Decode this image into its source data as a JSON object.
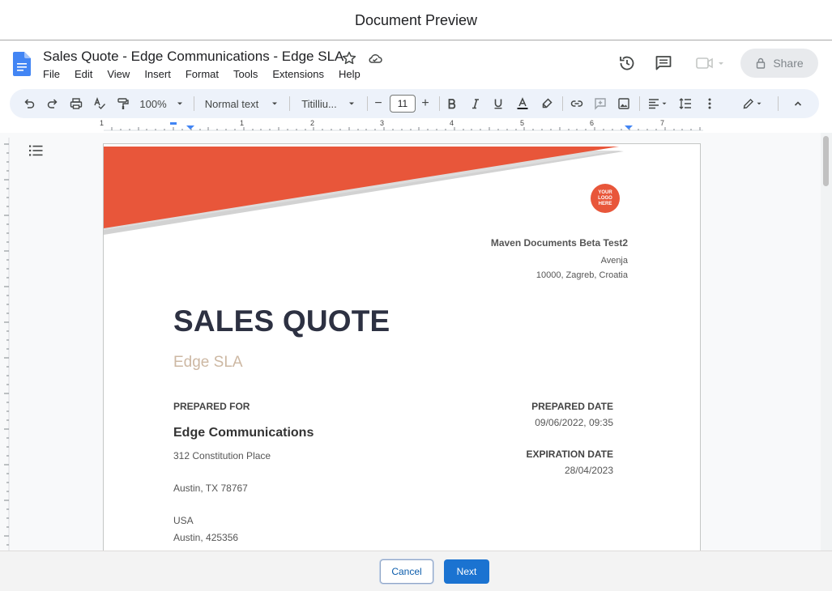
{
  "modal": {
    "title": "Document Preview"
  },
  "docs": {
    "title": "Sales Quote - Edge Communications - Edge SLA",
    "menu": [
      "File",
      "Edit",
      "View",
      "Insert",
      "Format",
      "Tools",
      "Extensions",
      "Help"
    ],
    "share_label": "Share",
    "icons": {
      "docs": "docs-icon",
      "star": "star-icon",
      "cloud": "cloud-icon",
      "history": "history-icon",
      "comments": "comment-icon",
      "meet": "video-icon",
      "lock": "lock-icon"
    }
  },
  "toolbar": {
    "zoom": "100%",
    "style": "Normal text",
    "font": "Titilliu...",
    "font_size": "11",
    "minus": "−",
    "plus": "+"
  },
  "ruler": {
    "numbers": [
      "1",
      "1",
      "2",
      "3",
      "4",
      "5",
      "6",
      "7"
    ]
  },
  "page": {
    "logo_text": "YOUR LOGO HERE",
    "company_name": "Maven Documents Beta Test2",
    "company_line1": "Avenja",
    "company_line2": "10000, Zagreb, Croatia",
    "heading": "SALES QUOTE",
    "subheading": "Edge SLA",
    "prepared_for_label": "PREPARED FOR",
    "client_name": "Edge Communications",
    "client_address1": "312 Constitution Place",
    "client_address2": "Austin, TX 78767",
    "client_country": "USA",
    "client_city_zip": "Austin, 425356",
    "prepared_date_label": "PREPARED DATE",
    "prepared_date": "09/06/2022, 09:35",
    "expiration_date_label": "EXPIRATION DATE",
    "expiration_date": "28/04/2023",
    "colors": {
      "accent": "#e8563a",
      "heading": "#2d3142",
      "subheading": "#cdb8a3"
    }
  },
  "footer": {
    "cancel_label": "Cancel",
    "next_label": "Next"
  }
}
